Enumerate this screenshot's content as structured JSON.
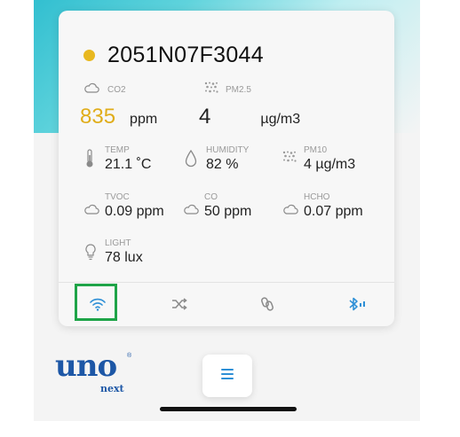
{
  "colors": {
    "status_dot": "#e8b81f",
    "co2_value": "#e0ad1a",
    "accent_blue": "#2d8fd6",
    "highlight_green": "#1ea448",
    "logo_blue": "#1d57a6"
  },
  "device": {
    "id": "2051N07F3044",
    "status": "online"
  },
  "primary": {
    "co2": {
      "label": "CO2",
      "value": "835",
      "unit": "ppm",
      "icon": "cloud-icon"
    },
    "pm25": {
      "label": "PM2.5",
      "value": "4",
      "unit": "µg/m3",
      "icon": "particles-icon"
    }
  },
  "metrics": {
    "temp": {
      "label": "TEMP",
      "value": "21.1 ˚C",
      "icon": "thermometer-icon"
    },
    "humidity": {
      "label": "HUMIDITY",
      "value": "82 %",
      "icon": "droplet-icon"
    },
    "pm10": {
      "label": "PM10",
      "value": "4 µg/m3",
      "icon": "particles-icon"
    },
    "tvoc": {
      "label": "TVOC",
      "value": "0.09 ppm",
      "icon": "cloud-icon"
    },
    "co": {
      "label": "CO",
      "value": "50 ppm",
      "icon": "cloud-icon"
    },
    "hcho": {
      "label": "HCHO",
      "value": "0.07 ppm",
      "icon": "cloud-icon"
    },
    "light": {
      "label": "LIGHT",
      "value": "78 lux",
      "icon": "lightbulb-icon"
    }
  },
  "tabs": [
    {
      "name": "wifi",
      "icon": "wifi-icon",
      "selected": true
    },
    {
      "name": "shuffle",
      "icon": "shuffle-icon"
    },
    {
      "name": "link",
      "icon": "link-icon"
    },
    {
      "name": "bluetooth",
      "icon": "bluetooth-icon"
    }
  ],
  "brand": {
    "name": "uno",
    "sub": "next",
    "registered": "®"
  },
  "menu": {
    "icon": "menu-icon"
  }
}
